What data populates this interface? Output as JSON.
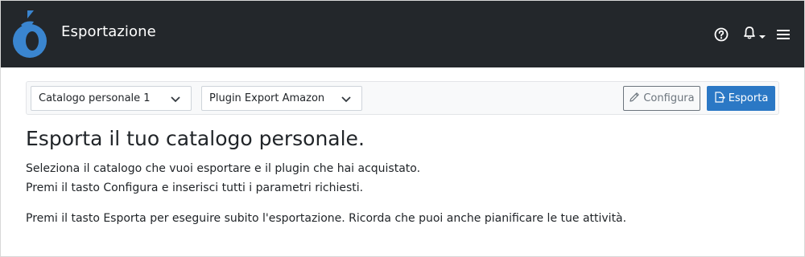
{
  "header": {
    "app_title": "Esportazione",
    "logo_icon": "brand-logo-icon",
    "icons": [
      "help-circle-icon",
      "bell-icon",
      "caret-down-icon",
      "hamburger-menu-icon"
    ],
    "bg_color": "#23272b"
  },
  "toolbar": {
    "catalog_select": {
      "value": "Catalogo personale 1"
    },
    "plugin_select": {
      "value": "Plugin Export Amazon"
    },
    "configure_label": "Configura",
    "export_label": "Esporta",
    "accent_color": "#2b78c5"
  },
  "main": {
    "heading": "Esporta il tuo catalogo personale.",
    "line1": "Seleziona il catalogo che vuoi esportare e il plugin che hai acquistato.",
    "line2": "Premi il tasto Configura e inserisci tutti i parametri richiesti.",
    "line3": "Premi il tasto Esporta per eseguire subito l'esportazione. Ricorda che puoi anche pianificare le tue attività."
  }
}
